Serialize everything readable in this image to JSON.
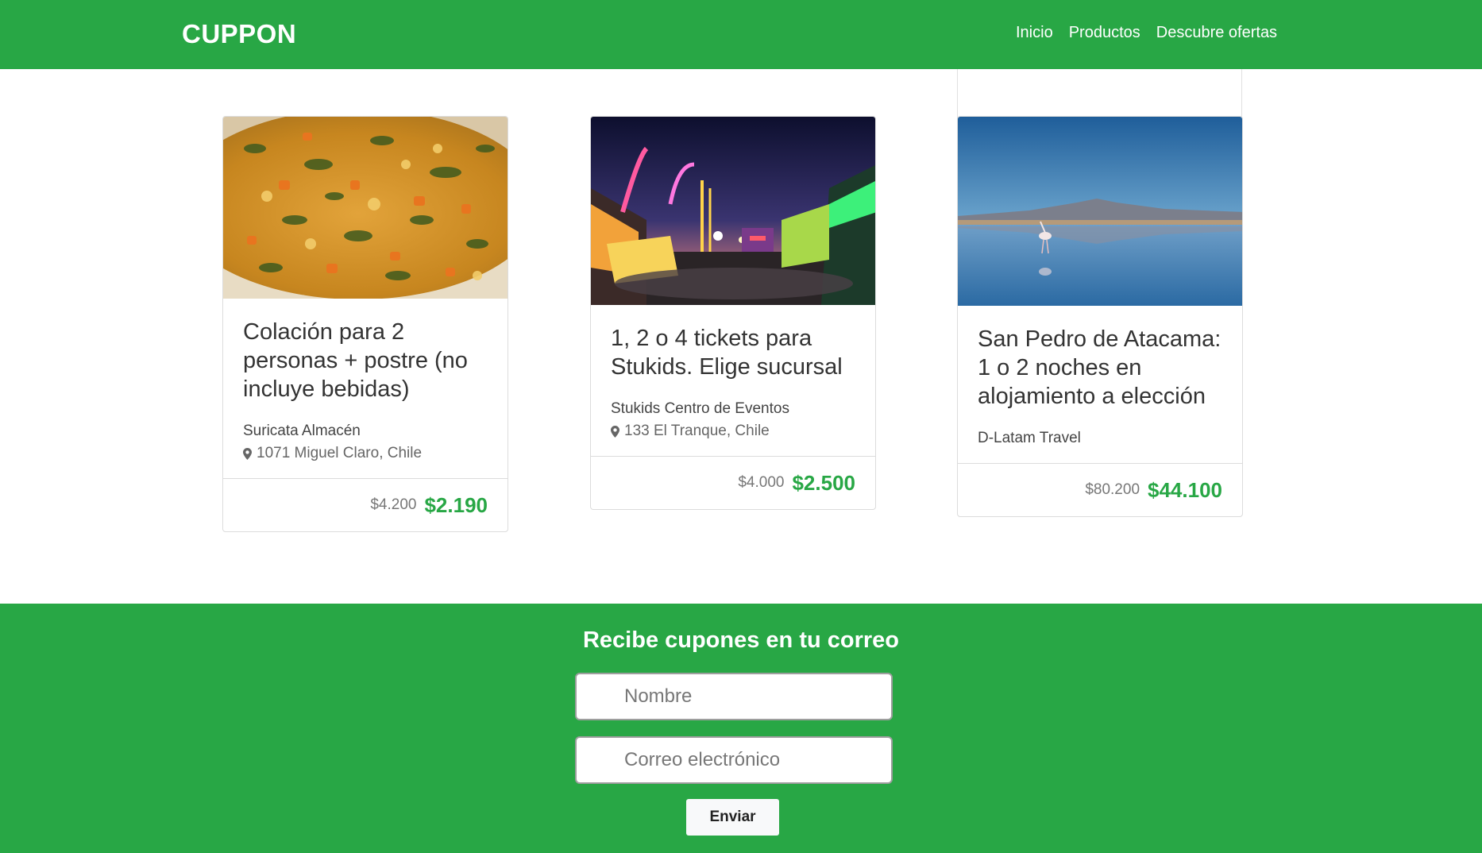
{
  "navbar": {
    "brand": "CUPPON",
    "links": [
      "Inicio",
      "Productos",
      "Descubre ofertas"
    ],
    "color": "#28a745"
  },
  "cards": [
    {
      "title": "Colación para 2 personas + postre (no incluye bebidas)",
      "merchant": "Suricata Almacén",
      "address": "1071 Miguel Claro, Chile",
      "old_price": "$4.200",
      "new_price": "$2.190",
      "image": "food-photo"
    },
    {
      "title": "1, 2 o 4 tickets para Stukids. Elige sucursal",
      "merchant": "Stukids Centro de Eventos",
      "address": "133 El Tranque, Chile",
      "old_price": "$4.000",
      "new_price": "$2.500",
      "image": "fair-night-photo"
    },
    {
      "title": "San Pedro de Atacama: 1 o 2 noches en alojamiento a elección",
      "merchant": "D-Latam Travel",
      "old_price": "$80.200",
      "new_price": "$44.100",
      "image": "flamingo-lake-photo"
    }
  ],
  "subscribe": {
    "title": "Recibe cupones en tu correo",
    "name_placeholder": "Nombre",
    "email_placeholder": "Correo electrónico",
    "button": "Enviar"
  }
}
